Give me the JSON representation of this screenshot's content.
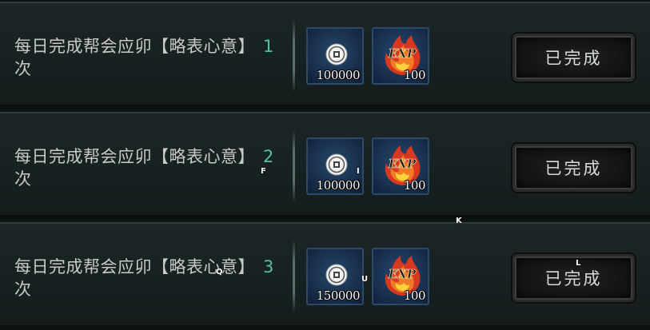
{
  "tasks": [
    {
      "text": "每日完成帮会应卯【略表心意】",
      "count": "1",
      "suffix": "次",
      "rewards": {
        "coin_amount": "100000",
        "exp_amount": "100"
      },
      "button_label": "已完成"
    },
    {
      "text": "每日完成帮会应卯【略表心意】",
      "count": "2",
      "suffix": "次",
      "rewards": {
        "coin_amount": "100000",
        "exp_amount": "100"
      },
      "button_label": "已完成"
    },
    {
      "text": "每日完成帮会应卯【略表心意】",
      "count": "3",
      "suffix": "次",
      "rewards": {
        "coin_amount": "150000",
        "exp_amount": "100"
      },
      "button_label": "已完成"
    }
  ],
  "icons": {
    "coin": "coin-icon",
    "exp": "exp-flame-icon",
    "exp_text": "EXP"
  },
  "colors": {
    "count_accent": "#4fc3a1",
    "row_bg": "#1c2626",
    "reward_bg": "#1a3250",
    "flame": "#e0492a"
  },
  "markers": [
    "F",
    "I",
    "K",
    "Q",
    "U",
    "L"
  ]
}
